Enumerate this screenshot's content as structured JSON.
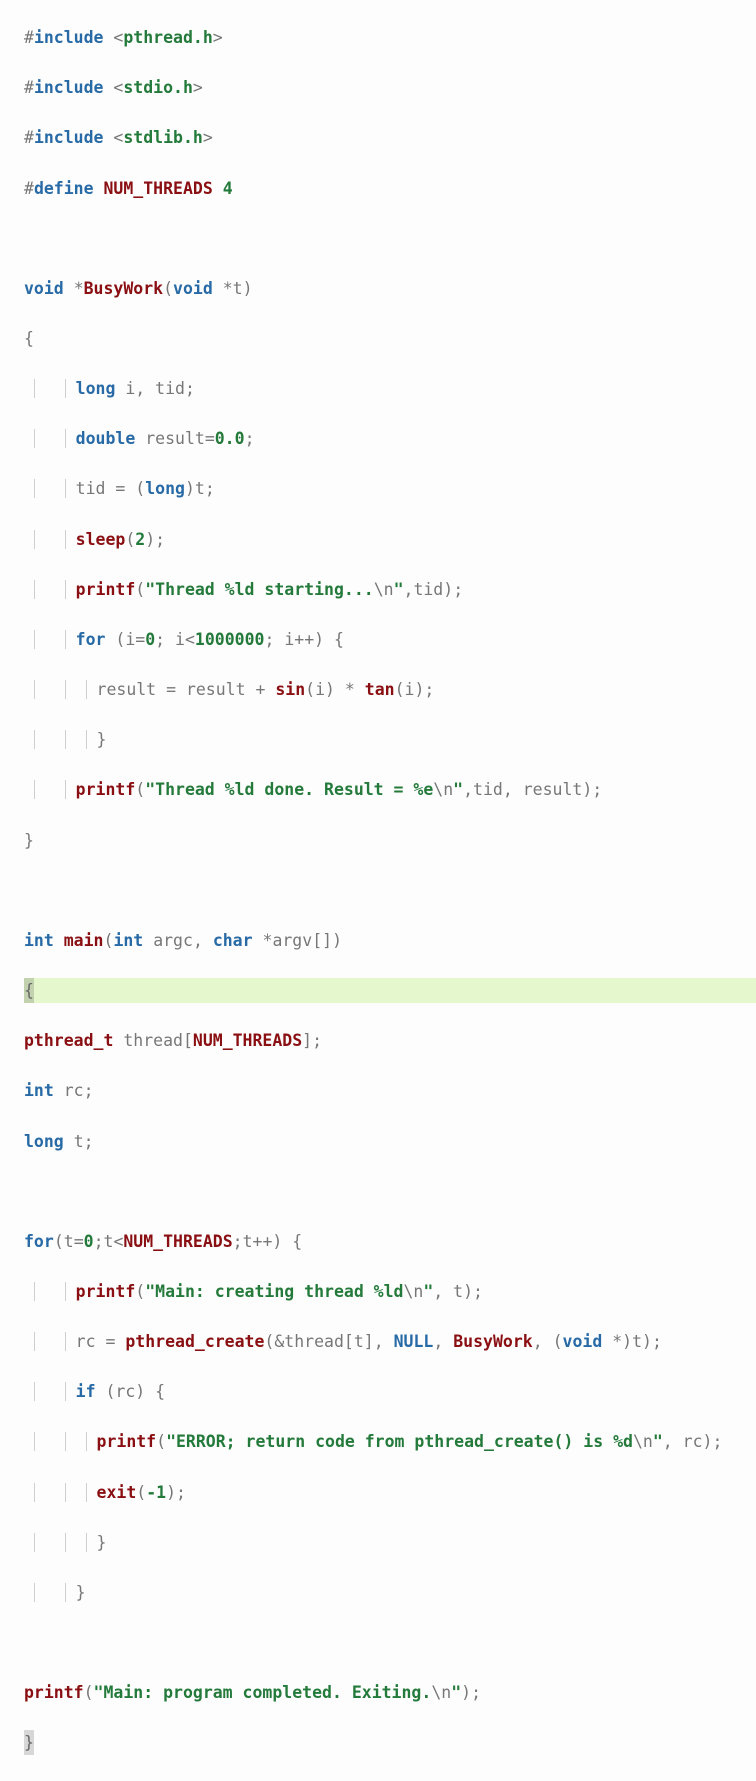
{
  "tokens": {
    "hash": "#",
    "include": "include",
    "define": "define",
    "lt": "<",
    "gt": ">",
    "hdr_pthread": "pthread.h",
    "hdr_stdio": "stdio.h",
    "hdr_stdlib": "stdlib.h",
    "mac_numthreads": "NUM_THREADS",
    "num_4": "4",
    "void": "void",
    "star": "*",
    "BusyWork": "BusyWork",
    "lpar": "(",
    "rpar": ")",
    "lbrace": "{",
    "rbrace": "}",
    "long": "long",
    "double": "double",
    "int": "int",
    "char": "char",
    "i": "i",
    "tid": "tid",
    "t": "t",
    "result": "result",
    "rc": "rc",
    "argc": "argc",
    "argv": "argv",
    "thread": "thread",
    "semicolon": ";",
    "comma": ",",
    "eq": "=",
    "num_0_0": "0.0",
    "num_0": "0",
    "num_2": "2",
    "num_1000000": "1000000",
    "num_minus1": "-1",
    "sleep": "sleep",
    "printf": "printf",
    "for": "for",
    "if": "if",
    "main": "main",
    "sin": "sin",
    "tan": "tan",
    "plus": "+",
    "pluss": "++",
    "less": "<",
    "NULL": "NULL",
    "amp": "&",
    "lbracket": "[",
    "rbracket": "]",
    "pthread_t": "pthread_t",
    "pthread_create": "pthread_create",
    "exit": "exit",
    "str_start": "\"Thread %ld starting...",
    "nl": "\\n",
    "quote": "\"",
    "str_done": "\"Thread %ld done. Result = %e",
    "str_main_create": "\"Main: creating thread %ld",
    "str_error": "\"ERROR; return code from pthread_create() is %d",
    "str_main_exit": "\"Main: program completed. Exiting.",
    "sp": " "
  }
}
